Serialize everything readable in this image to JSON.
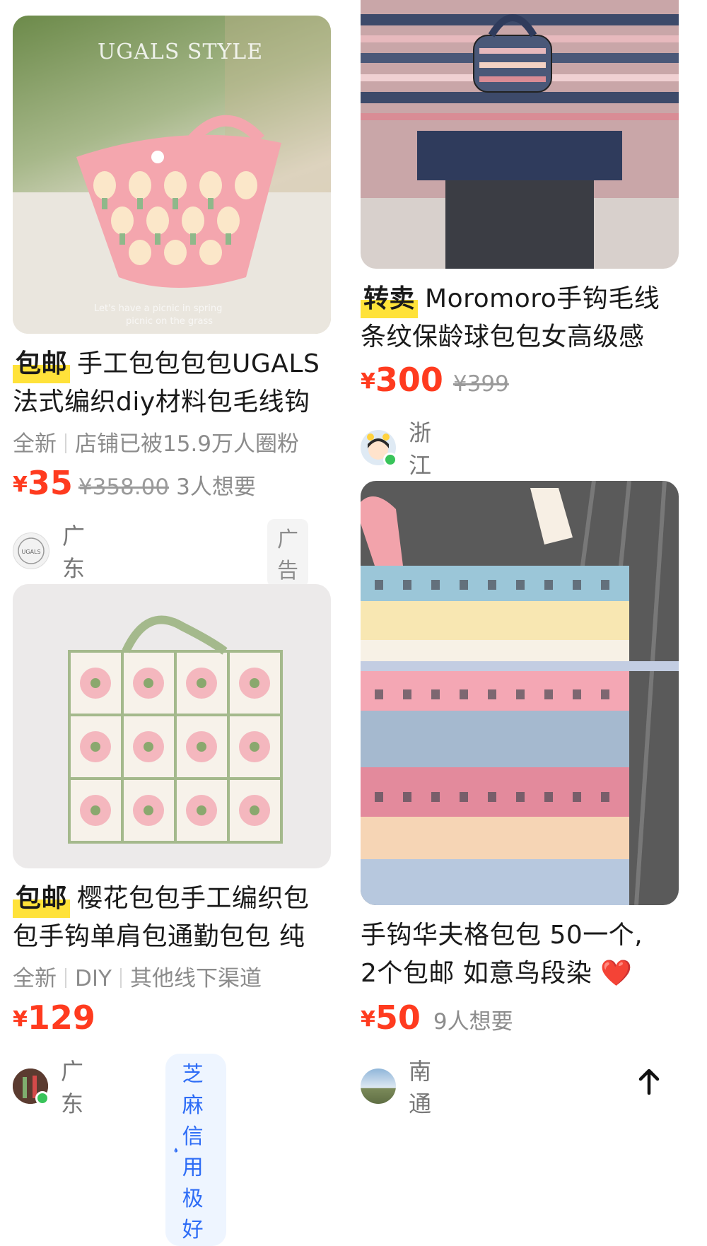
{
  "colors": {
    "price": "#ff3b1f",
    "tag_highlight": "#ffe23a",
    "credit": "#2d6cf6"
  },
  "cards": [
    {
      "watermark": "UGALS STYLE",
      "tag": "包邮",
      "title_line1": "手工包包包包UGALS",
      "title_line2": "法式编织diy材料包毛线钩",
      "meta": [
        "全新",
        "店铺已被15.9万人圈粉"
      ],
      "currency": "¥",
      "price": "35",
      "orig_price": "¥358.00",
      "want": "3人想要",
      "location": "广东",
      "badge": "广告"
    },
    {
      "tag": "转卖",
      "title_line1": "Moromoro手钩毛线",
      "title_line2": "条纹保龄球包包女高级感",
      "currency": "¥",
      "price": "300",
      "orig_price": "¥399",
      "location": "浙江"
    },
    {
      "tag": "包邮",
      "title_line1": "樱花包包手工编织包",
      "title_line2": "包手钩单肩包通勤包包 纯",
      "meta": [
        "全新",
        "DIY",
        "其他线下渠道"
      ],
      "currency": "¥",
      "price": "129",
      "location": "广东",
      "credit": "芝麻信用极好"
    },
    {
      "title_line1": "手钩华夫格包包 50一个,",
      "title_line2": "2个包邮 如意鸟段染",
      "emoji": "❤️",
      "currency": "¥",
      "price": "50",
      "want": "9人想要",
      "location": "南通"
    }
  ],
  "icons": {
    "scroll_top": "arrow-up-icon",
    "heart": "heart-emoji-icon",
    "credit": "drop-icon"
  }
}
